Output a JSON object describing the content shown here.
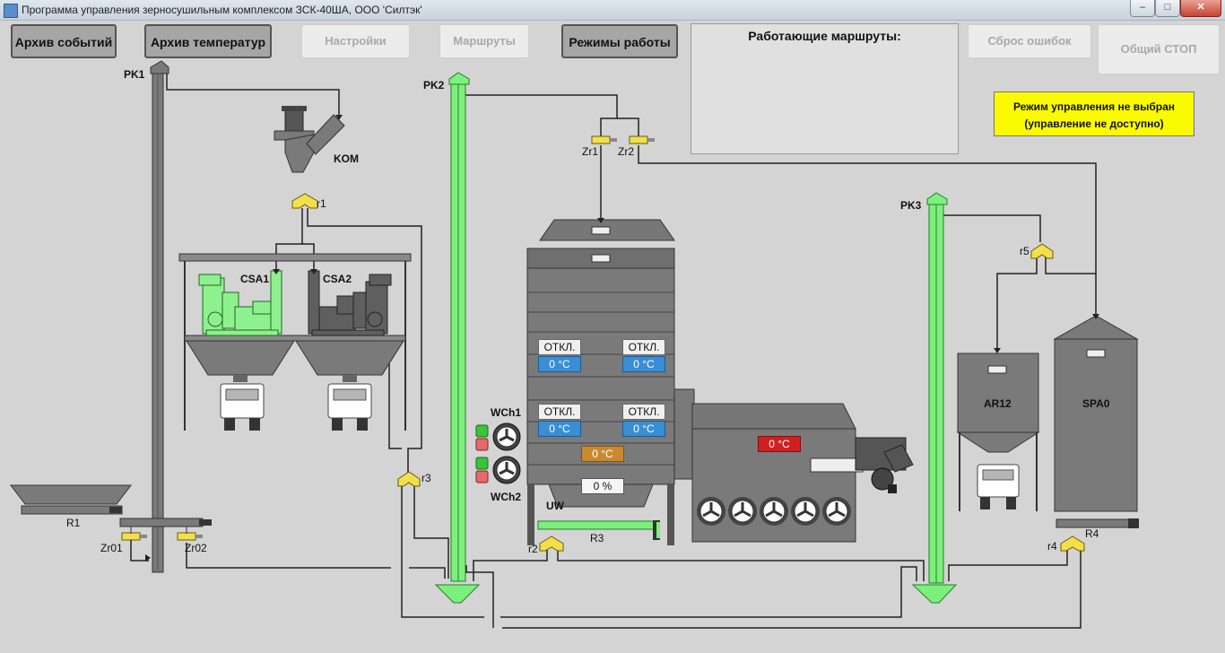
{
  "window": {
    "title": "Программа управления зерносушильным комплексом ЗСК-40ША, ООО 'Силтэк'",
    "minimize": "–",
    "maximize": "□",
    "close": "✕"
  },
  "toolbar": {
    "events_archive": "Архив событий",
    "temp_archive": "Архив температур",
    "settings": "Настройки",
    "routes": "Маршруты",
    "modes": "Режимы работы",
    "reset_errors": "Сброс ошибок",
    "general_stop": "Общий СТОП"
  },
  "routes_panel": {
    "title": "Работающие маршруты:"
  },
  "mode_status": {
    "line1": "Режим управления не выбран",
    "line2": "(управление не доступно)"
  },
  "labels": {
    "pk1": "PK1",
    "pk2": "PK2",
    "pk3": "PK3",
    "kom": "KOM",
    "r1": "r1",
    "r2": "r2",
    "r3": "r3",
    "r4": "r4",
    "r5": "r5",
    "csa1": "CSA1",
    "csa2": "CSA2",
    "zr1": "Zr1",
    "zr2": "Zr2",
    "zr01": "Zr01",
    "zr02": "Zr02",
    "r1_conveyor": "R1",
    "r3_conveyor": "R3",
    "r4_conveyor": "R4",
    "wch1": "WCh1",
    "wch2": "WCh2",
    "uw": "UW",
    "ar12": "AR12",
    "spa0": "SPA0"
  },
  "dryer": {
    "zone1": {
      "state": "ОТКЛ.",
      "temp": "0 °C"
    },
    "zone2": {
      "state": "ОТКЛ.",
      "temp": "0 °C"
    },
    "zone3": {
      "state": "ОТКЛ.",
      "temp": "0 °C"
    },
    "zone4": {
      "state": "ОТКЛ.",
      "temp": "0 °C"
    },
    "mid_temp": "0 °C",
    "moisture": "0 %",
    "burner_temp": "0 °C"
  },
  "colors": {
    "active_green": "#7cf07c",
    "inactive_gray": "#7a7a7a",
    "status_green": "#39c439",
    "status_red": "#e46b6b",
    "warning_yellow": "#fbfb00"
  }
}
